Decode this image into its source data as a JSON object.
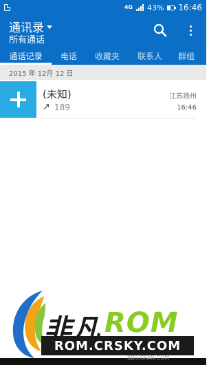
{
  "status_bar": {
    "network": "4G",
    "battery_percent": "43%",
    "battery_level": 0.43,
    "time": "16:46"
  },
  "app_bar": {
    "title": "通讯录",
    "subtitle": "所有通话",
    "icons": [
      "search-icon",
      "more-icon"
    ]
  },
  "tabs": [
    {
      "label": "通话记录",
      "active": true
    },
    {
      "label": "电话",
      "active": false
    },
    {
      "label": "收藏夹",
      "active": false
    },
    {
      "label": "联系人",
      "active": false
    },
    {
      "label": "群组",
      "active": false
    }
  ],
  "call_log": {
    "date_header": "2015 年 12月 12 日",
    "entries": [
      {
        "name": "(未知)",
        "direction_glyph": "↗",
        "number": "189",
        "location": "江苏扬州",
        "time": "16:46"
      }
    ]
  },
  "watermark": {
    "brand_a": "非凡",
    "brand_b": "ROM",
    "url": "ROM.CRSKY.COM",
    "forum": "BBS.GFAN.COM"
  },
  "colors": {
    "accent": "#0b6fc7",
    "avatar": "#2aabe4",
    "date_header_bg": "#e9e9e9",
    "brand_green": "#88cc22"
  }
}
